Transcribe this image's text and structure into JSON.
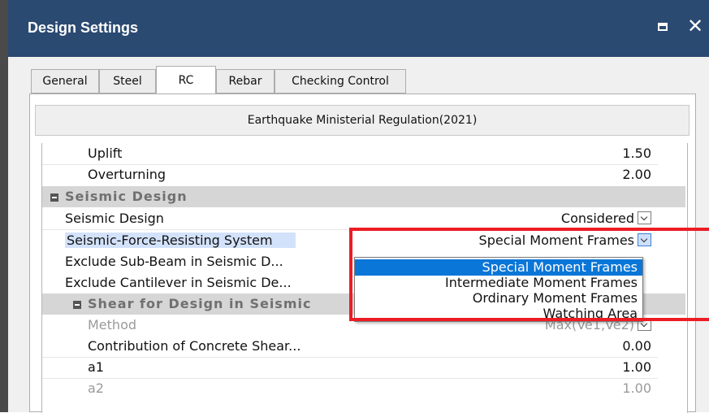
{
  "window": {
    "title": "Design Settings"
  },
  "tabs": [
    {
      "label": "General"
    },
    {
      "label": "Steel"
    },
    {
      "label": "RC"
    },
    {
      "label": "Rebar"
    },
    {
      "label": "Checking Control"
    }
  ],
  "section_header": "Earthquake Ministerial Regulation(2021)",
  "rows": {
    "uplift": {
      "name": "Uplift",
      "value": "1.50"
    },
    "overturning": {
      "name": "Overturning",
      "value": "2.00"
    },
    "seismic_group": {
      "name": "Seismic Design"
    },
    "seismic_design": {
      "name": "Seismic Design",
      "value": "Considered"
    },
    "sfrs": {
      "name": "Seismic-Force-Resisting System",
      "value": "Special Moment Frames"
    },
    "exclude_sub_beam": {
      "name": "Exclude Sub-Beam in Seismic D..."
    },
    "exclude_cantilever": {
      "name": "Exclude Cantilever in Seismic De..."
    },
    "shear_group": {
      "name": "Shear for Design in Seismic"
    },
    "method": {
      "name": "Method",
      "value": "Max(Ve1,Ve2)"
    },
    "contribution": {
      "name": "Contribution of Concrete Shear...",
      "value": "0.00"
    },
    "a1": {
      "name": "a1",
      "value": "1.00"
    },
    "a2": {
      "name": "a2",
      "value": "1.00"
    }
  },
  "dropdown_options": [
    "Special Moment Frames",
    "Intermediate Moment Frames",
    "Ordinary Moment Frames",
    "Watching Area"
  ],
  "colors": {
    "title_bar": "#2b4a72",
    "selected_option": "#0a76d8",
    "highlight_box": "#ec1c24",
    "selected_row": "#d3e2fb"
  }
}
